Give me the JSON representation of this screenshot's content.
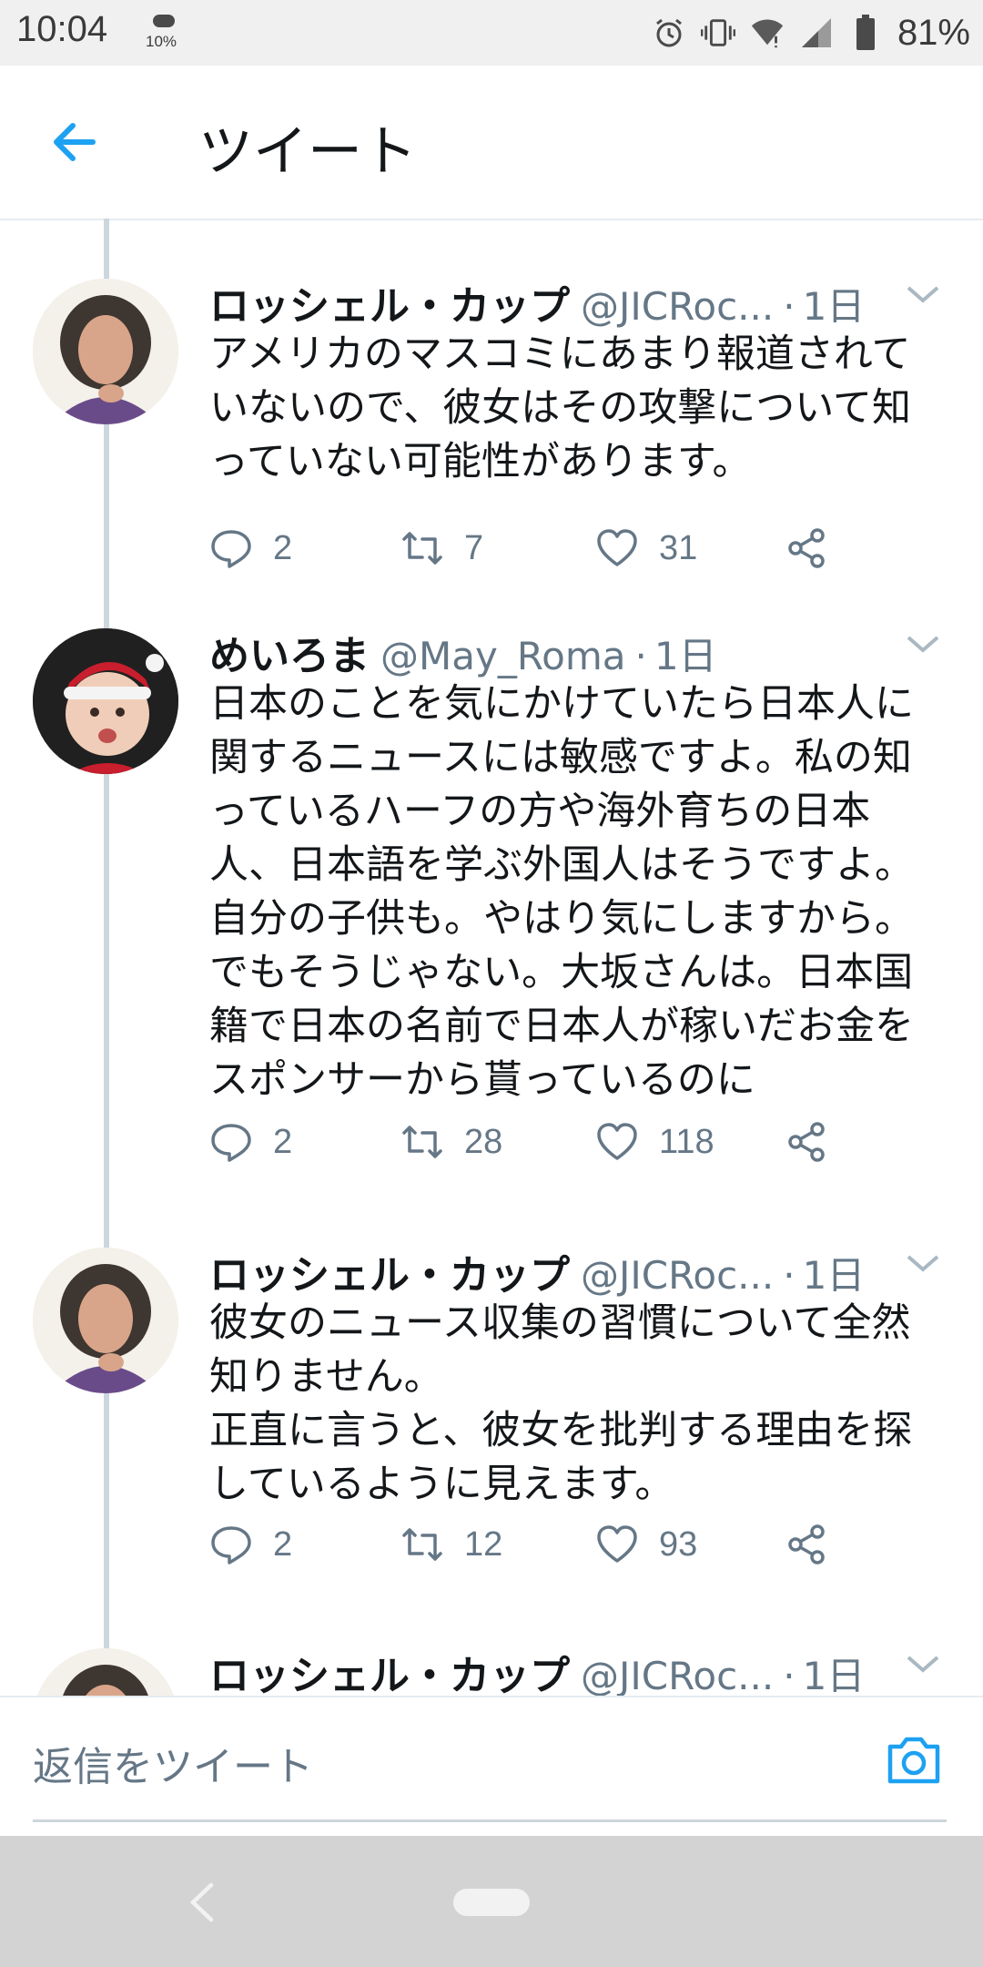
{
  "status_bar": {
    "time": "10:04",
    "weather_percent": "10%",
    "battery_percent": "81%",
    "icons": [
      "weather-cloud-icon",
      "alarm-icon",
      "vibrate-icon",
      "wifi-icon",
      "signal-icon",
      "battery-icon"
    ]
  },
  "header": {
    "title": "ツイート",
    "back_icon": "arrow-left-icon",
    "accent_color": "#1da1f2"
  },
  "tweets": [
    {
      "name": "ロッシェル・カップ",
      "handle": "@JICRoc...",
      "separator": "·",
      "time": "1日",
      "text": "アメリカのマスコミにあまり報道されて\nいないので、彼女はその攻撃について知\nっていない可能性があります。",
      "reply_count": "2",
      "retweet_count": "7",
      "like_count": "31"
    },
    {
      "name": "めいろま",
      "handle": "@May_Roma",
      "separator": "·",
      "time": "1日",
      "text": "日本のことを気にかけていたら日本人に\n関するニュースには敏感ですよ。私の知\nっているハーフの方や海外育ちの日本\n人、日本語を学ぶ外国人はそうですよ。\n自分の子供も。やはり気にしますから。\nでもそうじゃない。大坂さんは。日本国\n籍で日本の名前で日本人が稼いだお金を\nスポンサーから貰っているのに",
      "reply_count": "2",
      "retweet_count": "28",
      "like_count": "118"
    },
    {
      "name": "ロッシェル・カップ",
      "handle": "@JICRoc...",
      "separator": "·",
      "time": "1日",
      "text": "彼女のニュース収集の習慣について全然\n知りません。\n正直に言うと、彼女を批判する理由を探\nしているように見えます。",
      "reply_count": "2",
      "retweet_count": "12",
      "like_count": "93"
    },
    {
      "name": "ロッシェル・カップ",
      "handle": "@JICRoc...",
      "separator": "·",
      "time": "1日"
    }
  ],
  "reply_bar": {
    "placeholder": "返信をツイート",
    "camera_icon": "camera-icon"
  },
  "nav_bar": {
    "back_icon": "nav-back-icon",
    "home_icon": "nav-home-pill"
  }
}
